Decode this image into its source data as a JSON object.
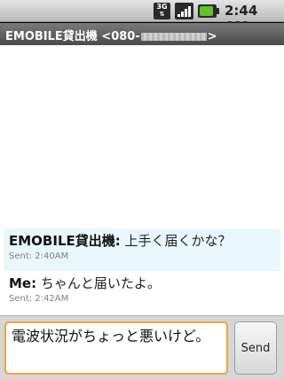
{
  "status_bar": {
    "network_label": "3G",
    "time": "2:44 AM",
    "icons": [
      "3g-icon",
      "signal-icon",
      "battery-icon"
    ]
  },
  "title": {
    "prefix": "EMOBILE貸出機 <080-",
    "suffix": ">"
  },
  "messages": [
    {
      "sender": "EMOBILE貸出機:",
      "text": " 上手く届くかな？",
      "sent": "Sent: 2:40AM"
    },
    {
      "sender": "Me:",
      "text": " ちゃんと届いたよ。",
      "sent": "Sent: 2:42AM"
    }
  ],
  "compose": {
    "value": "電波状況がちょっと悪いけど。",
    "send_label": "Send"
  },
  "colors": {
    "input_focus": "#f0a33a",
    "incoming_bg": "#e8f7fb",
    "battery": "#62c322"
  }
}
